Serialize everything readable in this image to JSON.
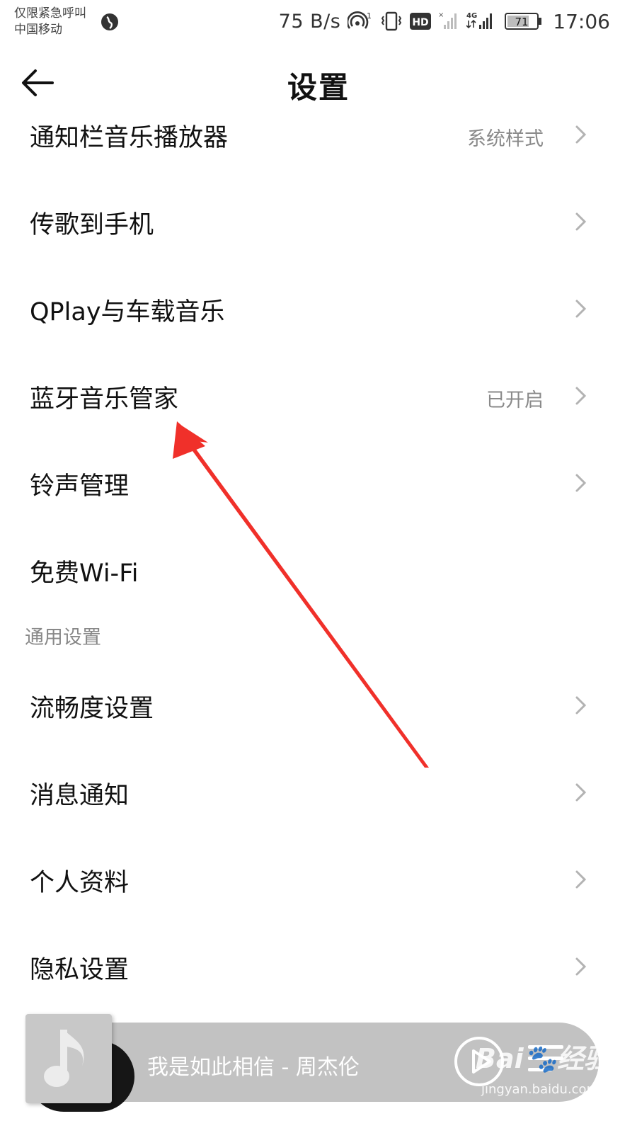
{
  "status_bar": {
    "carrier_line1": "仅限紧急呼叫",
    "carrier_line2": "中国移动",
    "net_speed": "75 B/s",
    "hd_label": "HD",
    "network_type": "4G",
    "battery": "71",
    "time": "17:06"
  },
  "header": {
    "title": "设置"
  },
  "settings": {
    "group1": [
      {
        "label": "通知栏音乐播放器",
        "value": "系统样式",
        "chevron": true
      },
      {
        "label": "传歌到手机",
        "value": "",
        "chevron": true
      },
      {
        "label": "QPlay与车载音乐",
        "value": "",
        "chevron": true
      },
      {
        "label": "蓝牙音乐管家",
        "value": "已开启",
        "chevron": true
      },
      {
        "label": "铃声管理",
        "value": "",
        "chevron": true
      },
      {
        "label": "免费Wi-Fi",
        "value": "",
        "chevron": false
      }
    ],
    "section_general": "通用设置",
    "group2": [
      {
        "label": "流畅度设置",
        "chevron": true
      },
      {
        "label": "消息通知",
        "chevron": true
      },
      {
        "label": "个人资料",
        "chevron": true
      },
      {
        "label": "隐私设置",
        "chevron": true
      }
    ]
  },
  "mini_player": {
    "song": "我是如此相信 - 周杰伦"
  },
  "watermark": {
    "logo": "Bai🐾经验",
    "url": "jingyan.baidu.com"
  },
  "colors": {
    "annotation_arrow": "#f0302a",
    "player_bg": "#c2c2c2",
    "secondary_text": "#8a8a8a"
  }
}
